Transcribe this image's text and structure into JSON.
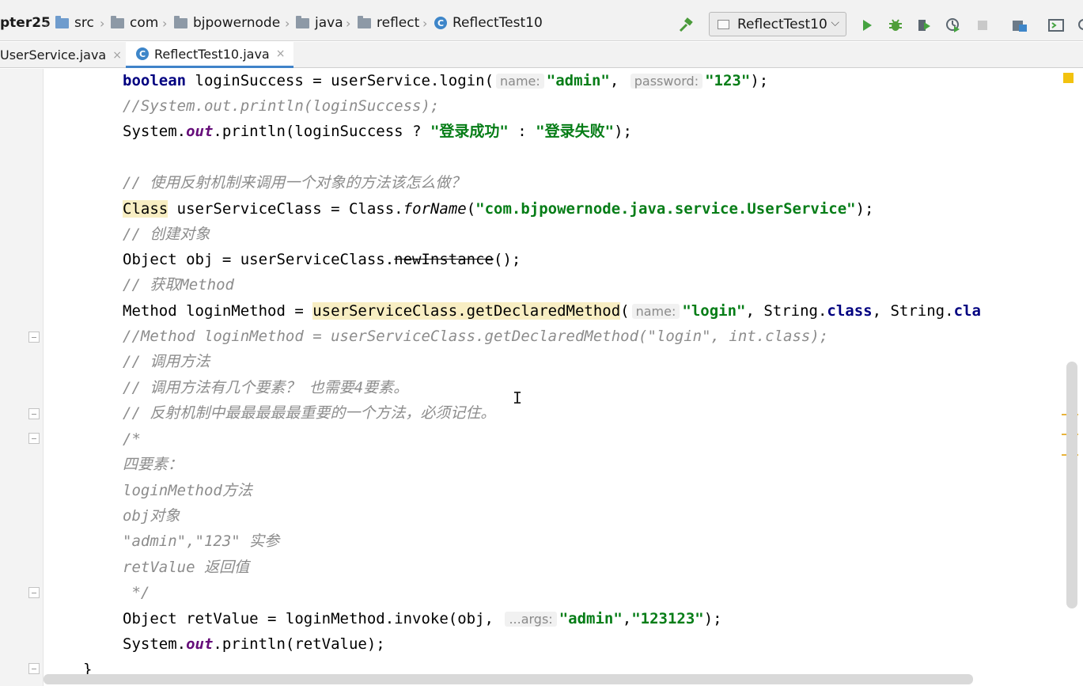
{
  "breadcrumb": [
    {
      "label": "pter25",
      "icon": "none",
      "bold": true
    },
    {
      "label": "src",
      "icon": "blue-folder-icon"
    },
    {
      "label": "com",
      "icon": "folder-icon"
    },
    {
      "label": "bjpowernode",
      "icon": "folder-icon"
    },
    {
      "label": "java",
      "icon": "folder-icon"
    },
    {
      "label": "reflect",
      "icon": "folder-icon"
    },
    {
      "label": "ReflectTest10",
      "icon": "class-icon"
    }
  ],
  "toolbar": {
    "run_config": "ReflectTest10",
    "buttons": [
      "build-hammer-icon",
      "run-icon",
      "debug-icon",
      "coverage-icon",
      "profile-icon",
      "stop-icon",
      "project-structure-icon",
      "terminal-icon"
    ]
  },
  "tabs": [
    {
      "label": "UserService.java",
      "active": false
    },
    {
      "label": "ReflectTest10.java",
      "active": true
    }
  ],
  "code": {
    "l1_kw": "boolean",
    "l1_a": " loginSuccess = userService.login(",
    "l1_hint1": "name:",
    "l1_s1": "\"admin\"",
    "l1_b": ", ",
    "l1_hint2": "password:",
    "l1_s2": "\"123\"",
    "l1_c": ");",
    "l2": "//System.out.println(loginSuccess);",
    "l3_a": "System.",
    "l3_out": "out",
    "l3_b": ".println(loginSuccess ? ",
    "l3_s1": "\"登录成功\"",
    "l3_c": " : ",
    "l3_s2": "\"登录失败\"",
    "l3_d": ");",
    "l5": "// 使用反射机制来调用一个对象的方法该怎么做？",
    "l6_cls": "Class",
    "l6_a": " userServiceClass = Class.",
    "l6_fn": "forName",
    "l6_b": "(",
    "l6_s": "\"com.bjpowernode.java.service.UserService\"",
    "l6_c": ");",
    "l7": "// 创建对象",
    "l8_a": "Object obj = userServiceClass.",
    "l8_dep": "newInstance",
    "l8_b": "();",
    "l9": "// 获取Method",
    "l10_a": "Method loginMethod = ",
    "l10_hl": "userServiceClass.getDeclaredMethod",
    "l10_b": "(",
    "l10_hint": "name:",
    "l10_s": "\"login\"",
    "l10_c": ", String.",
    "l10_kw1": "class",
    "l10_d": ", String.",
    "l10_kw2": "cla",
    "l11": "//Method loginMethod = userServiceClass.getDeclaredMethod(\"login\", int.class);",
    "l12": "// 调用方法",
    "l13": "// 调用方法有几个要素？ 也需要4要素。",
    "l14": "// 反射机制中最最最最最重要的一个方法，必须记住。",
    "l15": "/*",
    "l16": "四要素：",
    "l17": "loginMethod方法",
    "l18": "obj对象",
    "l19": "\"admin\",\"123\" 实参",
    "l20": "retValue 返回值",
    "l21": " */",
    "l22_a": "Object retValue = loginMethod.invoke(obj, ",
    "l22_hint": "...args:",
    "l22_s1": "\"admin\"",
    "l22_b": ",",
    "l22_s2": "\"123123\"",
    "l22_c": ");",
    "l23_a": "System.",
    "l23_out": "out",
    "l23_b": ".println(retValue);",
    "close_brace": "}"
  }
}
